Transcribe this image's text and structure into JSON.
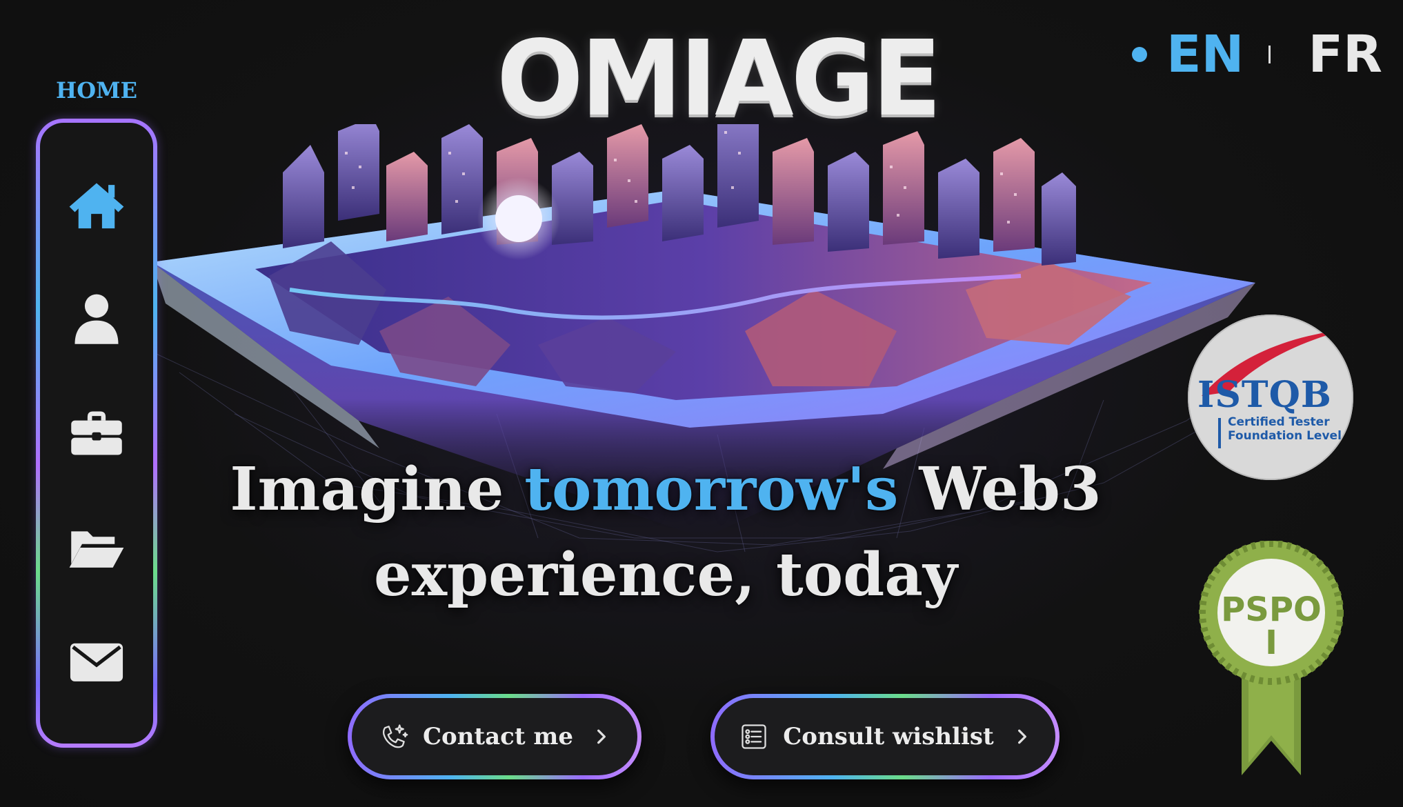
{
  "brand": {
    "title": "OMIAGE"
  },
  "language": {
    "active": "EN",
    "other": "FR",
    "active_color": "#4fb3f0"
  },
  "sidebar": {
    "current_label": "HOME",
    "items": [
      {
        "name": "home",
        "icon": "home-icon",
        "active": true
      },
      {
        "name": "about",
        "icon": "user-icon",
        "active": false
      },
      {
        "name": "experience",
        "icon": "briefcase-icon",
        "active": false
      },
      {
        "name": "projects",
        "icon": "folder-open-icon",
        "active": false
      },
      {
        "name": "contact",
        "icon": "envelope-icon",
        "active": false
      }
    ]
  },
  "hero": {
    "headline_before": "Imagine ",
    "headline_accent": "tomorrow's",
    "headline_after": " Web3",
    "headline_line2": "experience, today",
    "illustration": "low-poly-floating-city-island"
  },
  "buttons": {
    "contact": {
      "label": "Contact me",
      "icon": "phone-sparkle-icon"
    },
    "wishlist": {
      "label": "Consult wishlist",
      "icon": "list-icon"
    }
  },
  "badges": {
    "istqb": {
      "name": "ISTQB",
      "line1": "Certified Tester",
      "line2": "Foundation Level"
    },
    "pspo": {
      "line1": "PSPO",
      "line2": "I"
    }
  },
  "colors": {
    "accent": "#4fb3f0",
    "background": "#121212",
    "text": "#e9e9e9",
    "istqb_blue": "#1e5aa8",
    "pspo_green": "#7a9a3e"
  }
}
